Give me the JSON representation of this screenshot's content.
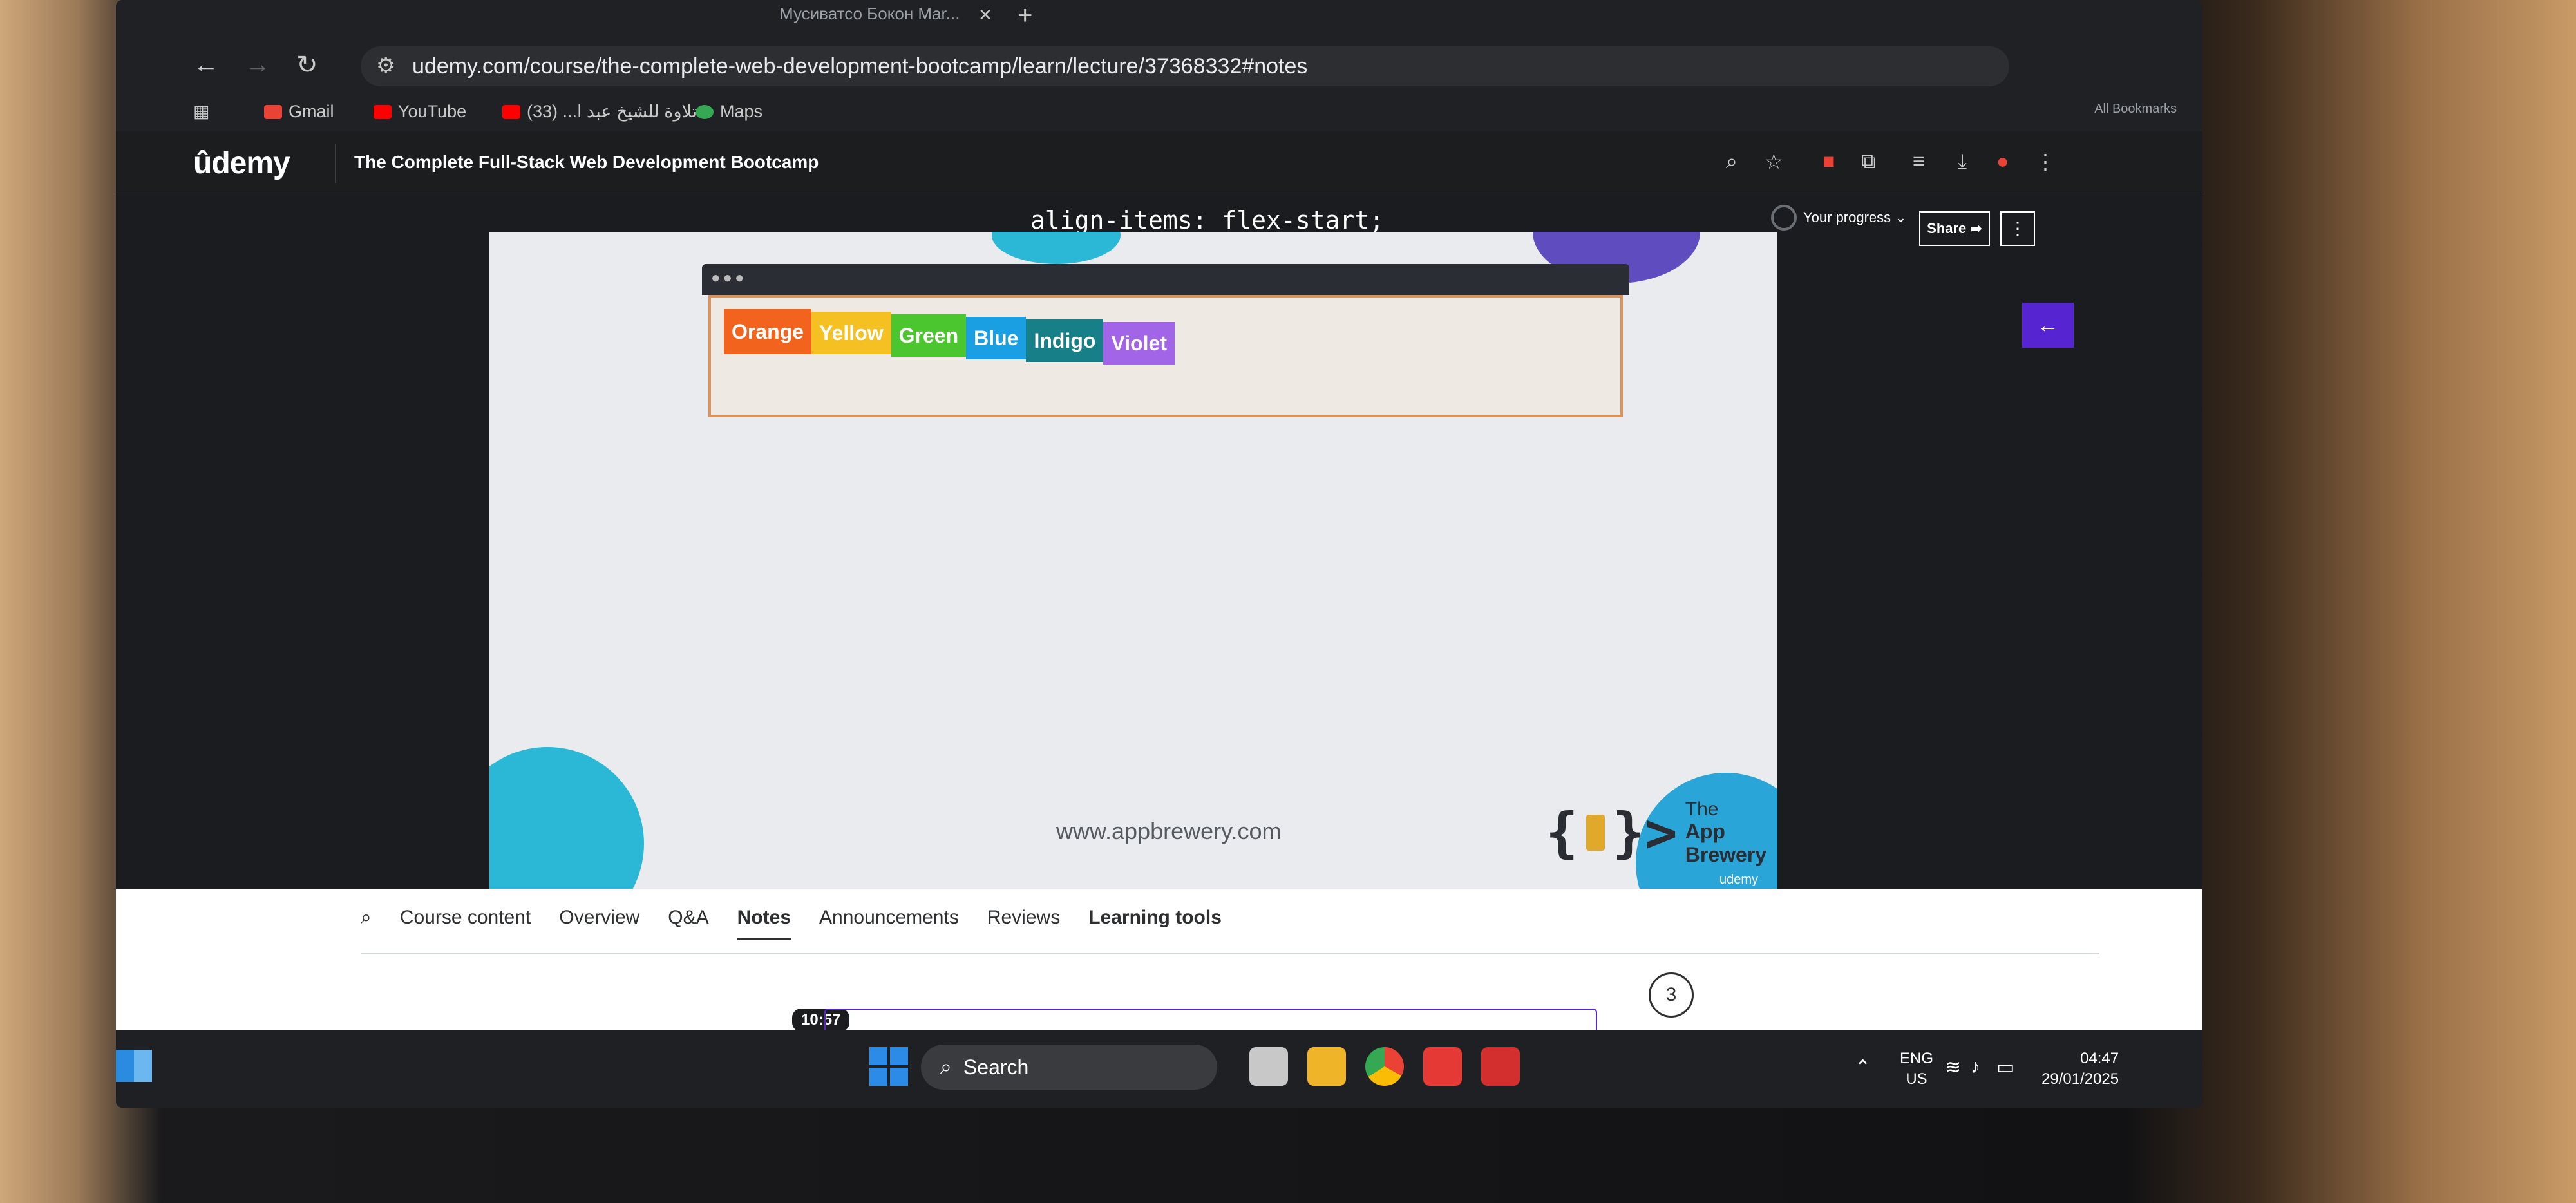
{
  "browser": {
    "tab_title": "Мусиватсо Бокон Mar...",
    "url": "udemy.com/course/the-complete-web-development-bootcamp/learn/lecture/37368332#notes",
    "bookmarks": [
      {
        "label": "Gmail",
        "icon": "gmail-icon",
        "color": "#ea4335"
      },
      {
        "label": "YouTube",
        "icon": "youtube-icon",
        "color": "#ff0000"
      },
      {
        "label": "تلاوة للشيخ عبد ا... (33)",
        "icon": "youtube-icon",
        "color": "#ff0000"
      },
      {
        "label": "Maps",
        "icon": "maps-icon",
        "color": "#34a853"
      }
    ],
    "all_bookmarks": "All Bookmarks"
  },
  "udemy": {
    "logo": "ûdemy",
    "course_title": "The Complete Full-Stack Web Development Bootcamp",
    "progress_label": "Your progress ⌄",
    "share_label": "Share ➦",
    "more_label": "⋮",
    "accent": "#5624d0"
  },
  "video": {
    "caption": "align-items: flex-start;",
    "colors": [
      {
        "label": "Orange",
        "bg": "#f2641e"
      },
      {
        "label": "Yellow",
        "bg": "#f4c022"
      },
      {
        "label": "Green",
        "bg": "#4cc62e"
      },
      {
        "label": "Blue",
        "bg": "#1a9fe3"
      },
      {
        "label": "Indigo",
        "bg": "#167f87"
      },
      {
        "label": "Violet",
        "bg": "#a265e8"
      }
    ],
    "site": "www.appbrewery.com",
    "brand_line1": "The",
    "brand_line2": "App Brewery",
    "watermark": "udemy"
  },
  "panel": {
    "tabs": [
      "Course content",
      "Overview",
      "Q&A",
      "Notes",
      "Announcements",
      "Reviews",
      "Learning tools"
    ],
    "active_tab": "Notes",
    "bubble": "3",
    "time": "10:57"
  },
  "taskbar": {
    "search": "Search",
    "lang_line1": "ENG",
    "lang_line2": "US",
    "time": "04:47",
    "date": "29/01/2025"
  }
}
